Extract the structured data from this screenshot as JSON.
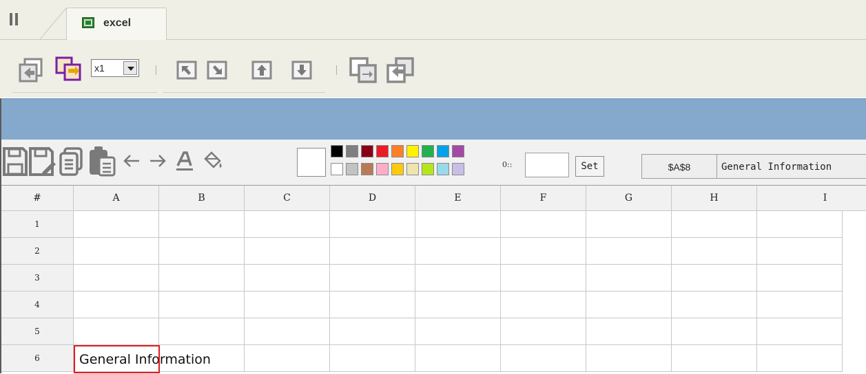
{
  "tab": {
    "label": "excel",
    "icon": "excel-sheet-icon"
  },
  "toolbar2": {
    "zoom_value": "x1",
    "icons": [
      "copy-back-icon",
      "move-to-front-icon",
      "align-top-left-icon",
      "align-bottom-right-icon",
      "move-up-icon",
      "move-down-icon",
      "bring-forward-icon",
      "send-backward-icon"
    ]
  },
  "sheet_toolbar": {
    "icons": [
      "save-icon",
      "save-as-icon",
      "copy-icon",
      "paste-icon",
      "undo-arrow-icon",
      "redo-arrow-icon",
      "font-color-icon",
      "fill-bucket-icon"
    ],
    "palette_top": [
      "#000000",
      "#7f7f7f",
      "#880015",
      "#ed1c24",
      "#ff7f27",
      "#fff200",
      "#22b14c",
      "#00a2e8",
      "#a349a4"
    ],
    "palette_bottom": [
      "#ffffff",
      "#c3c3c3",
      "#b97a57",
      "#ffaec9",
      "#ffc90e",
      "#efe4b0",
      "#b5e61d",
      "#99d9ea",
      "#c8bfe7"
    ],
    "border_size_label": "0::",
    "set_label": "Set",
    "cell_ref": "$A$8",
    "cell_value": "General Information"
  },
  "grid": {
    "corner": "#",
    "columns": [
      "A",
      "B",
      "C",
      "D",
      "E",
      "F",
      "G",
      "H",
      "I"
    ],
    "rows": [
      "1",
      "2",
      "3",
      "4",
      "5",
      "6"
    ],
    "cell_a6": "General Information"
  },
  "colors": {
    "blue_band": "#85a9cc",
    "selection": "#e31b1b"
  }
}
